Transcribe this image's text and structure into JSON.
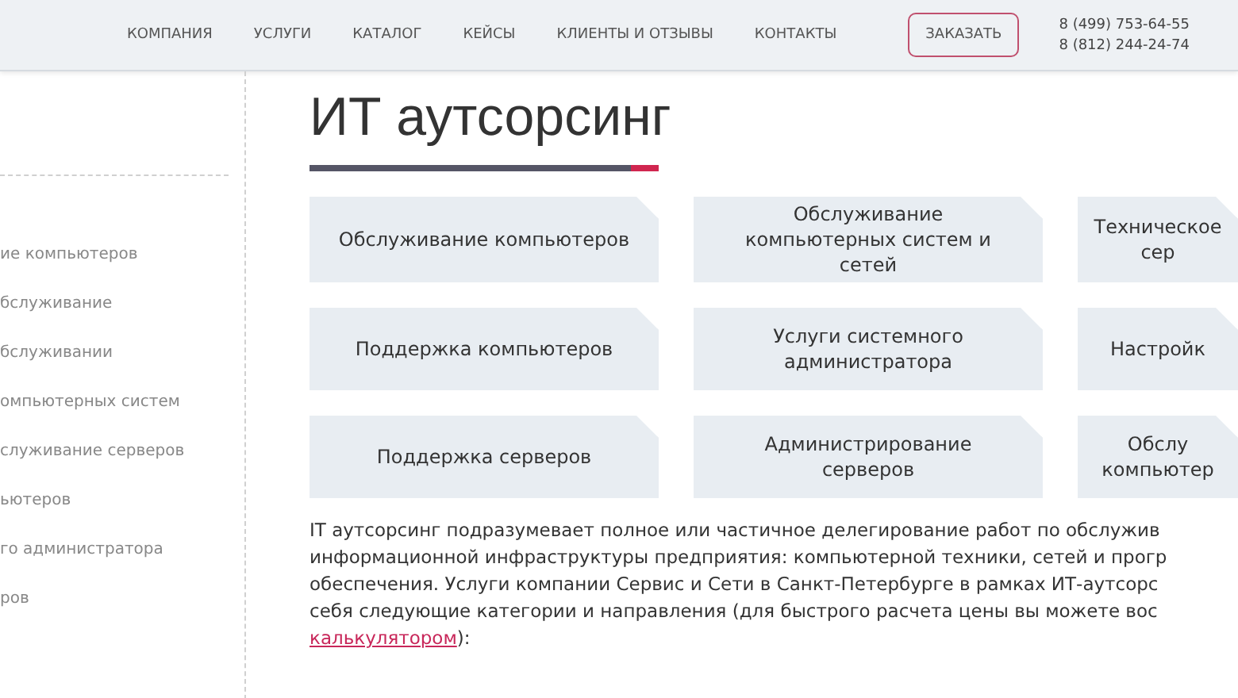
{
  "header": {
    "nav": [
      {
        "label": "КОМПАНИЯ"
      },
      {
        "label": "УСЛУГИ"
      },
      {
        "label": "КАТАЛОГ"
      },
      {
        "label": "КЕЙСЫ"
      },
      {
        "label": "КЛИЕНТЫ И ОТЗЫВЫ"
      },
      {
        "label": "КОНТАКТЫ"
      }
    ],
    "order_button": "ЗАКАЗАТЬ",
    "phones": [
      "8 (499) 753-64-55",
      "8 (812) 244-24-74"
    ]
  },
  "sidebar": {
    "items": [
      {
        "label": "ие компьютеров"
      },
      {
        "label": "бслуживание"
      },
      {
        "label": "бслуживании"
      },
      {
        "label": "омпьютерных систем"
      },
      {
        "label": "служивание серверов"
      },
      {
        "label": "ьютеров"
      },
      {
        "label": "го администратора"
      },
      {
        "label": "ров"
      }
    ]
  },
  "title": "ИТ аутсорсинг",
  "cards": [
    {
      "lines": [
        "Обслуживание компьютеров"
      ]
    },
    {
      "lines": [
        "Обслуживание",
        "компьютерных систем и",
        "сетей"
      ]
    },
    {
      "lines": [
        "Техническое",
        "сер"
      ]
    },
    {
      "lines": [
        "Поддержка компьютеров"
      ]
    },
    {
      "lines": [
        "Услуги системного",
        "администратора"
      ]
    },
    {
      "lines": [
        "Настройк"
      ]
    },
    {
      "lines": [
        "Поддержка серверов"
      ]
    },
    {
      "lines": [
        "Администрирование",
        "серверов"
      ]
    },
    {
      "lines": [
        "Обслу",
        "компьютер"
      ]
    }
  ],
  "paragraph_lines": [
    "IT аутсорсинг подразумевает полное или частичное делегирование работ по обслужив",
    "информационной инфраструктуры предприятия: компьютерной техники, сетей и прогр",
    "обеспечения. Услуги компании Сервис и Сети в Санкт-Петербурге в рамках ИТ-аутсорс",
    "себя следующие категории и направления (для быстрого расчета цены вы можете вос"
  ],
  "link": "калькулятором",
  "link_tail": "):"
}
